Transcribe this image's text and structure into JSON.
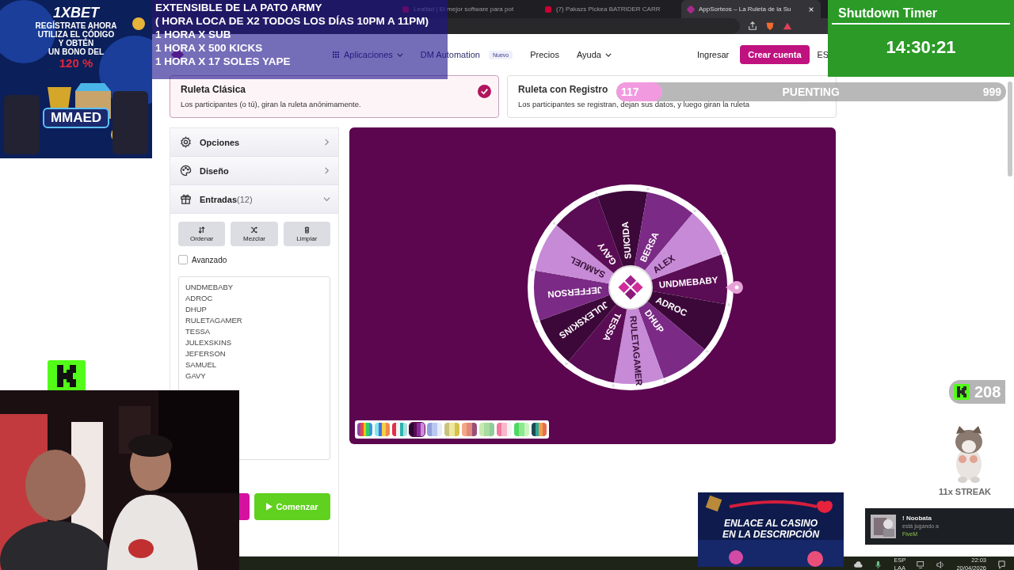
{
  "browser": {
    "tabs": [
      {
        "title": "Lealtad | El mejor software para pot",
        "selected": false
      },
      {
        "title": "(7) Pakazs Pickea BATRIDER CARR",
        "selected": false
      },
      {
        "title": "AppSorteos – La Ruleta de la Su",
        "selected": true
      }
    ]
  },
  "site_header": {
    "nav": [
      {
        "label": "Aplicaciones",
        "kind": "dropdown"
      },
      {
        "label": "DM Automation",
        "kind": "link",
        "badge": "Nuevo"
      },
      {
        "label": "Precios",
        "kind": "link"
      },
      {
        "label": "Ayuda",
        "kind": "dropdown"
      }
    ],
    "login": "Ingresar",
    "signup": "Crear cuenta",
    "language": "ES"
  },
  "modes": [
    {
      "title": "Ruleta Clásica",
      "description": "Los participantes (o tú), giran la ruleta anónimamente.",
      "selected": true
    },
    {
      "title": "Ruleta con Registro",
      "description": "Los participantes se registran, dejan sus datos, y luego giran la ruleta",
      "selected": false
    }
  ],
  "sidebar": {
    "sections": [
      {
        "label": "Opciones",
        "kind": "options",
        "expanded": false
      },
      {
        "label": "Diseño",
        "kind": "design",
        "expanded": false
      },
      {
        "label": "Entradas",
        "count": "(12)",
        "kind": "entries",
        "expanded": true
      }
    ],
    "tools": [
      {
        "label": "Ordenar",
        "kind": "sort"
      },
      {
        "label": "Mezclar",
        "kind": "shuffle"
      },
      {
        "label": "Limpiar",
        "kind": "clear"
      }
    ],
    "advanced": {
      "label": "Avanzado",
      "checked": false
    },
    "entries": [
      "UNDMEBABY",
      "ADROC",
      "DHUP",
      "RULETAGAMER",
      "TESSA",
      "JULEXSKINS",
      "JEFERSON",
      "SAMUEL",
      "GAVY"
    ],
    "start": "Comenzar"
  },
  "wheel": {
    "segments": [
      {
        "label": "UNDMEBABY",
        "color": "#5a0c54"
      },
      {
        "label": "ADROC",
        "color": "#3c0839"
      },
      {
        "label": "DHUP",
        "color": "#7b2a86"
      },
      {
        "label": "RULETAGAMER",
        "color": "#c68ad6"
      },
      {
        "label": "TESSA",
        "color": "#5a0c54"
      },
      {
        "label": "JULEXSKINS",
        "color": "#3c0839"
      },
      {
        "label": "JEFFERSON",
        "color": "#7b2a86"
      },
      {
        "label": "SAMUEL",
        "color": "#c68ad6"
      },
      {
        "label": "GAVY",
        "color": "#5a0c54"
      },
      {
        "label": "SUICIDA",
        "color": "#3c0839"
      },
      {
        "label": "BERSA",
        "color": "#7b2a86"
      },
      {
        "label": "ALEX",
        "color": "#c68ad6"
      }
    ]
  },
  "palettes": [
    {
      "selected": false
    },
    {
      "selected": false
    },
    {
      "selected": false
    },
    {
      "selected": true
    },
    {
      "selected": false
    },
    {
      "selected": false
    },
    {
      "selected": false
    },
    {
      "selected": false
    },
    {
      "selected": false
    },
    {
      "selected": false
    },
    {
      "selected": false
    }
  ],
  "overlays": {
    "ad": {
      "brand": "1XBET",
      "lines": [
        "REGÍSTRATE AHORA",
        "UTILIZA EL CÓDIGO",
        "Y OBTÉN",
        "UN BONO DEL"
      ],
      "bonus": "120 %",
      "code": "MMAED"
    },
    "announcement": {
      "lines": [
        "EXTENSIBLE  DE LA PATO ARMY",
        "( HORA LOCA DE X2 TODOS LOS DÍAS 10PM A 11PM)",
        "1 HORA X SUB",
        "1 HORA X 500 KICKS",
        "1 HORA X 17 SOLES YAPE"
      ]
    },
    "timer": {
      "title": "Shutdown Timer",
      "time": "14:30:21"
    },
    "goal": {
      "current": "117",
      "label": "PUENTING",
      "target": "999",
      "level": 0.117
    },
    "kick_count": "208",
    "streak": "11x STREAK",
    "casino": {
      "lines": [
        "ENLACE AL CASINO",
        "EN LA DESCRIPCIÓN"
      ]
    },
    "notification": {
      "name": "! Noobata",
      "status": "está jugando a",
      "game": "FiveM"
    }
  },
  "taskbar": {
    "language": [
      "ESP",
      "LAA"
    ],
    "time": "22:03",
    "date": "20/04/2026"
  }
}
